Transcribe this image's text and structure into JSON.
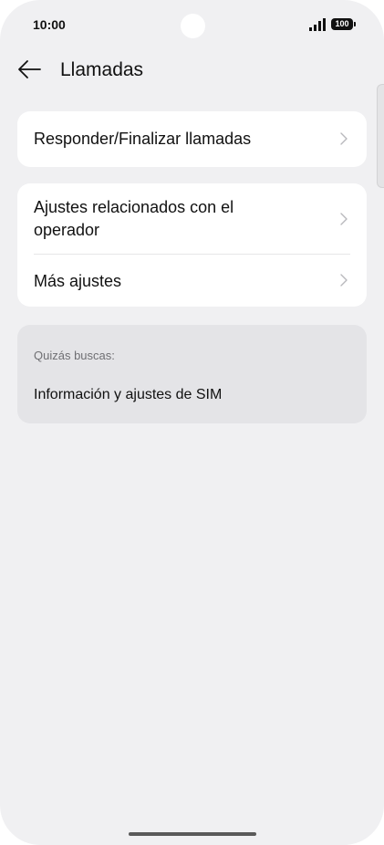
{
  "status_bar": {
    "time": "10:00",
    "battery": "100"
  },
  "header": {
    "title": "Llamadas",
    "back_icon": "arrow-left-icon"
  },
  "settings": {
    "group1": [
      {
        "label": "Responder/Finalizar llamadas",
        "icon": "chevron-right-icon"
      }
    ],
    "group2": [
      {
        "label": "Ajustes relacionados con el operador",
        "icon": "chevron-right-icon"
      },
      {
        "label": "Más ajustes",
        "icon": "chevron-right-icon"
      }
    ]
  },
  "suggestions": {
    "caption": "Quizás buscas:",
    "items": [
      {
        "label": "Información y ajustes de SIM"
      }
    ]
  },
  "colors": {
    "background": "#f0f0f2",
    "card": "#ffffff",
    "suggestion_card": "#e4e4e7",
    "text": "#111111",
    "muted_text": "#6f6f73"
  }
}
